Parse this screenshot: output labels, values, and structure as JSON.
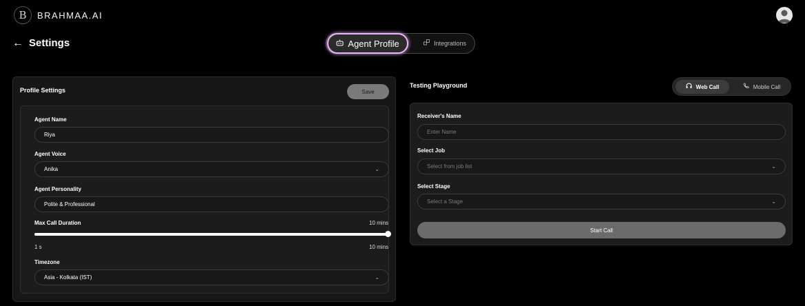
{
  "brand": {
    "logo_letter": "B",
    "name": "BRAHMAA.AI"
  },
  "header": {
    "title": "Settings"
  },
  "tabs": [
    {
      "label": "Agent Profile",
      "active": true
    },
    {
      "label": "Integrations",
      "active": false
    }
  ],
  "profile": {
    "heading": "Profile Settings",
    "save_label": "Save",
    "agent_name": {
      "label": "Agent Name",
      "value": "Riya"
    },
    "agent_voice": {
      "label": "Agent Voice",
      "value": "Anika"
    },
    "agent_personality": {
      "label": "Agent Personality",
      "value": "Polite & Professional"
    },
    "max_call_duration": {
      "label": "Max Call Duration",
      "current": "10 mins",
      "min_label": "1 s",
      "max_label": "10 mins",
      "fill_fraction": 1.0
    },
    "timezone": {
      "label": "Timezone",
      "value": "Asia - Kolkata (IST)"
    }
  },
  "playground": {
    "heading": "Testing Playground",
    "call_types": [
      {
        "label": "Web Call",
        "active": true
      },
      {
        "label": "Mobile Call",
        "active": false
      }
    ],
    "receiver_name": {
      "label": "Receiver's Name",
      "placeholder": "Enter Name"
    },
    "select_job": {
      "label": "Select Job",
      "placeholder": "Select from job list"
    },
    "select_stage": {
      "label": "Select Stage",
      "placeholder": "Select a Stage"
    },
    "start_label": "Start Call"
  },
  "icons": {
    "back": "arrow-left-icon",
    "agent_profile": "robot-icon",
    "integrations": "plug-icon",
    "web_call": "headset-icon",
    "mobile_call": "phone-icon",
    "dropdown": "chevron-down-icon",
    "avatar": "user-icon"
  },
  "colors": {
    "accent_glow": "#e9b7f5",
    "background": "#000000",
    "panel": "#171717"
  }
}
